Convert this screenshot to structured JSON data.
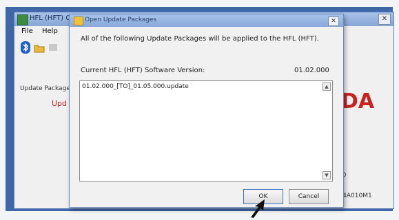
{
  "main_window": {
    "title": "HFL (HFT) Com",
    "close_glyph": "✕",
    "menu": {
      "file": "File",
      "help": "Help"
    },
    "left_label": "Update Package",
    "left_red_text": "Upd",
    "brand_text": "DA",
    "right_text_1": "00",
    "right_text_2": "X4A010M1"
  },
  "dialog": {
    "title": "Open Update Packages",
    "close_glyph": "✕",
    "message": "All of the following Update Packages will be applied to the HFL (HFT).",
    "version_label": "Current HFL (HFT) Software Version:",
    "version_value": "01.02.000",
    "packages": [
      "01.02.000_[TO]_01.05.000.update"
    ],
    "scroll_up_glyph": "▲",
    "scroll_down_glyph": "▼",
    "ok_label": "OK",
    "cancel_label": "Cancel"
  },
  "colors": {
    "desktop": "#3f66a7",
    "brand_red": "#c8231f",
    "title_bar": "#93b2e0"
  }
}
